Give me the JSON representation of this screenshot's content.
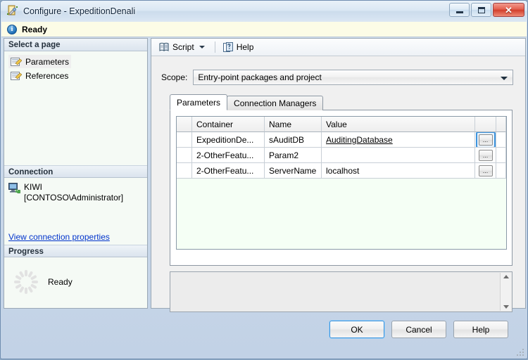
{
  "window": {
    "title": "Configure - ExpeditionDenali",
    "icon": "configure-wizard-icon",
    "minimize_label": "Minimize",
    "maximize_label": "Maximize",
    "close_label": "Close"
  },
  "infobar": {
    "icon": "info-icon",
    "glyph": "i",
    "text": "Ready"
  },
  "sidebar": {
    "pages_header": "Select a page",
    "pages": [
      {
        "label": "Parameters",
        "icon": "page-icon",
        "selected": true
      },
      {
        "label": "References",
        "icon": "page-icon",
        "selected": false
      }
    ],
    "connection_header": "Connection",
    "connection": {
      "icon": "server-icon",
      "server": "KIWI",
      "user": "[CONTOSO\\Administrator]",
      "link": "View connection properties"
    },
    "progress_header": "Progress",
    "progress": {
      "icon": "spinner-icon",
      "status": "Ready"
    }
  },
  "toolbar": {
    "script_label": "Script",
    "script_icon": "script-icon",
    "script_caret": "chevron-down-icon",
    "help_label": "Help",
    "help_icon": "help-icon"
  },
  "scope": {
    "label": "Scope:",
    "value": "Entry-point packages and project",
    "arrow_icon": "chevron-down-icon"
  },
  "tabs": [
    {
      "label": "Parameters",
      "active": true
    },
    {
      "label": "Connection Managers",
      "active": false
    }
  ],
  "grid": {
    "columns": [
      "",
      "Container",
      "Name",
      "Value",
      "",
      ""
    ],
    "rows": [
      {
        "container": "ExpeditionDe...",
        "name": "sAuditDB",
        "value": "AuditingDatabase",
        "value_underlined": true,
        "button": "...",
        "button_focused": true
      },
      {
        "container": "2-OtherFeatu...",
        "name": "Param2",
        "value": "",
        "value_underlined": false,
        "button": "...",
        "button_focused": false
      },
      {
        "container": "2-OtherFeatu...",
        "name": "ServerName",
        "value": "localhost",
        "value_underlined": false,
        "button": "...",
        "button_focused": false
      }
    ]
  },
  "description_panel": {
    "text": "",
    "scroll_up_icon": "scroll-up-arrow-icon",
    "scroll_down_icon": "scroll-down-arrow-icon"
  },
  "footer": {
    "ok": "OK",
    "cancel": "Cancel",
    "help": "Help"
  },
  "colors": {
    "accent_blue": "#3c93dd",
    "link_blue": "#0033cc",
    "info_bar_bg": "#fcfce6",
    "close_red": "#d23f2c",
    "grid_bg": "#f5fff5"
  }
}
